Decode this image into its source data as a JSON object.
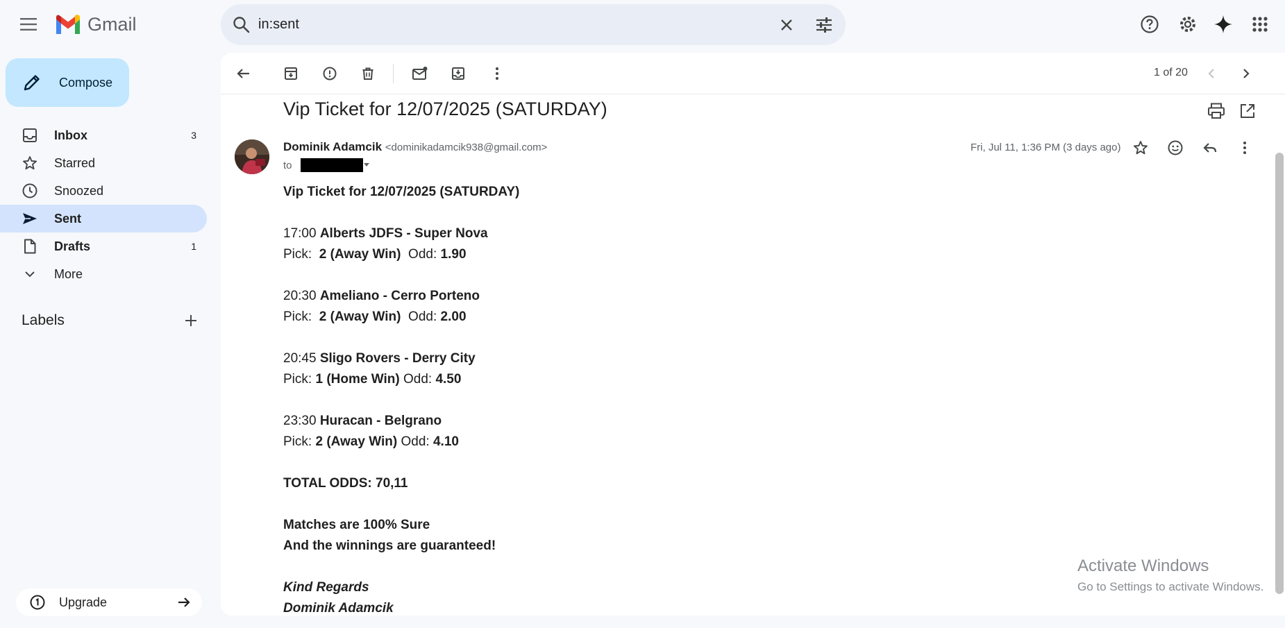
{
  "app": {
    "name": "Gmail"
  },
  "search": {
    "query": "in:sent"
  },
  "sidebar": {
    "compose_label": "Compose",
    "items": [
      {
        "label": "Inbox",
        "count": "3",
        "icon": "inbox-icon"
      },
      {
        "label": "Starred",
        "count": "",
        "icon": "star-icon"
      },
      {
        "label": "Snoozed",
        "count": "",
        "icon": "clock-icon"
      },
      {
        "label": "Sent",
        "count": "",
        "icon": "send-icon"
      },
      {
        "label": "Drafts",
        "count": "1",
        "icon": "draft-icon"
      },
      {
        "label": "More",
        "count": "",
        "icon": "chevron-down-icon"
      }
    ],
    "labels_title": "Labels",
    "upgrade_label": "Upgrade"
  },
  "toolbar": {
    "pager": "1 of 20"
  },
  "email": {
    "subject": "Vip Ticket for 12/07/2025 (SATURDAY)",
    "sender_name": "Dominik Adamcik",
    "sender_email": "<dominikadamcik938@gmail.com>",
    "to_label": "to",
    "date": "Fri, Jul 11, 1:36 PM (3 days ago)",
    "heading": "Vip Ticket for 12/07/2025 (SATURDAY)",
    "matches": [
      {
        "time": "17:00",
        "teams": "Alberts JDFS - Super Nova",
        "pick_label": "Pick:",
        "pick": "2 (Away Win)",
        "odd_label": "Odd:",
        "odd": "1.90"
      },
      {
        "time": "20:30",
        "teams": "Ameliano - Cerro Porteno",
        "pick_label": "Pick:",
        "pick": "2 (Away Win)",
        "odd_label": "Odd:",
        "odd": "2.00"
      },
      {
        "time": "20:45",
        "teams": "Sligo Rovers - Derry City",
        "pick_label": "Pick:",
        "pick": "1 (Home Win)",
        "odd_label": "Odd:",
        "odd": "4.50"
      },
      {
        "time": "23:30",
        "teams": "Huracan - Belgrano",
        "pick_label": "Pick:",
        "pick": "2 (Away Win)",
        "odd_label": "Odd:",
        "odd": "4.10"
      }
    ],
    "total": "TOTAL ODDS: 70,11",
    "sure_line": "Matches are 100% Sure",
    "guarantee_line": "And the winnings are guaranteed!",
    "regards": "Kind Regards",
    "signature": "Dominik Adamcik"
  },
  "watermark": {
    "line1": "Activate Windows",
    "line2": "Go to Settings to activate Windows."
  },
  "colors": {
    "active_nav": "#d3e3fd",
    "compose_bg": "#c2e7ff",
    "search_bg": "#e9eef6",
    "page_bg": "#f6f8fc"
  }
}
